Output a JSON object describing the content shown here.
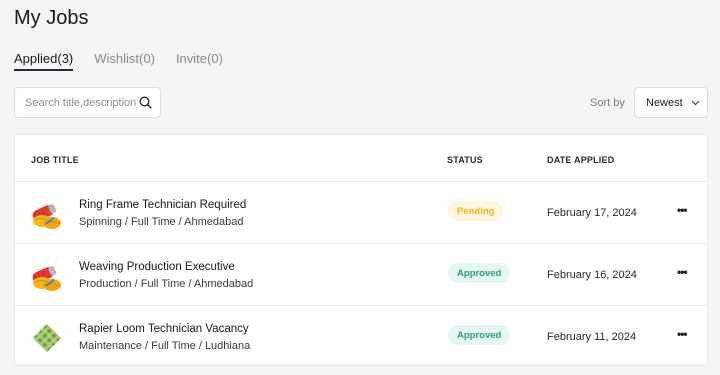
{
  "page": {
    "title": "My Jobs"
  },
  "tabs": [
    {
      "label": "Applied(3)",
      "active": true
    },
    {
      "label": "Wishlist(0)",
      "active": false
    },
    {
      "label": "Invite(0)",
      "active": false
    }
  ],
  "search": {
    "placeholder": "Search title,description",
    "value": "",
    "icon": "search-icon"
  },
  "sort": {
    "label": "Sort by",
    "selected": "Newest",
    "icon": "chevron-down-icon"
  },
  "table": {
    "columns": [
      "JOB TITLE",
      "STATUS",
      "DATE APPLIED"
    ],
    "rows": [
      {
        "title": "Ring Frame Technician Required",
        "meta": "Spinning / Full Time / Ahmedabad",
        "status": "Pending",
        "date": "February 17, 2024",
        "thumb": "yarn-spools-icon",
        "more": "•••"
      },
      {
        "title": "Weaving Production Executive",
        "meta": "Production / Full Time / Ahmedabad",
        "status": "Approved",
        "date": "February 16, 2024",
        "thumb": "yarn-spools-icon",
        "more": "•••"
      },
      {
        "title": "Rapier Loom Technician Vacancy",
        "meta": "Maintenance / Full Time / Ludhiana",
        "status": "Approved",
        "date": "February 11, 2024",
        "thumb": "woven-fabric-icon",
        "more": "•••"
      }
    ]
  },
  "colors": {
    "pending": "#f2b31c",
    "approved": "#27a082",
    "tab_underline": "#1f2a44"
  }
}
